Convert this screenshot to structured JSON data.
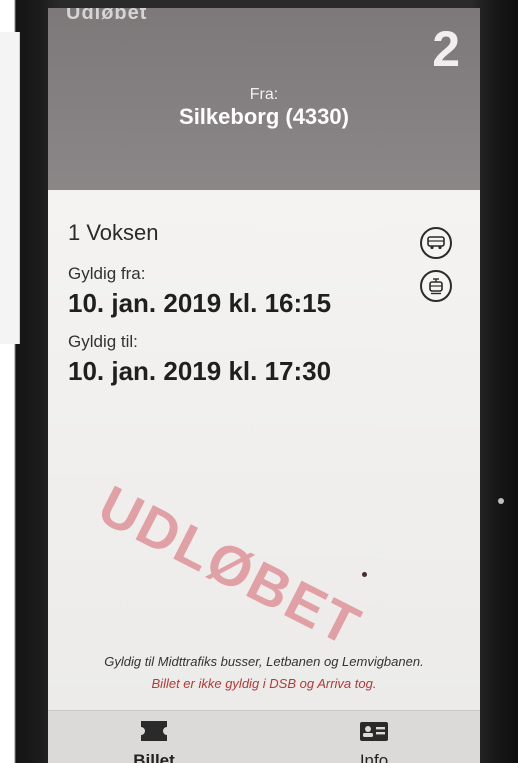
{
  "header": {
    "status": "Udløbet",
    "count": "2",
    "from_label": "Fra:",
    "from_value": "Silkeborg (4330)"
  },
  "ticket": {
    "passenger": "1 Voksen",
    "valid_from_label": "Gyldig fra:",
    "valid_from_value": "10. jan. 2019 kl. 16:15",
    "valid_to_label": "Gyldig til:",
    "valid_to_value": "10. jan. 2019 kl. 17:30",
    "stamp": "UDLØBET",
    "stamp_color": "#d6606c",
    "modes": [
      "bus-icon",
      "tram-icon"
    ]
  },
  "footer": {
    "validity_note": "Gyldig til Midttrafiks busser, Letbanen og Lemvigbanen.",
    "validity_warning": "Billet er ikke gyldig i DSB og Arriva tog.",
    "warning_color": "#b33a3a"
  },
  "nav": {
    "billet_label": "Billet",
    "billet_icon": "ticket-icon",
    "info_label": "Info",
    "info_icon": "id-card-icon"
  }
}
